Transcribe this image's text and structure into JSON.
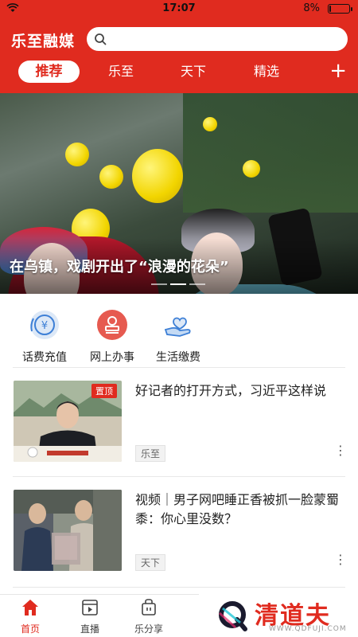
{
  "status_bar": {
    "time": "17:07",
    "battery": "8%",
    "battery_level": 0.08
  },
  "header": {
    "app_title": "乐至融媒",
    "search_placeholder": "",
    "tabs": [
      {
        "label": "推荐",
        "active": true
      },
      {
        "label": "乐至",
        "active": false
      },
      {
        "label": "天下",
        "active": false
      },
      {
        "label": "精选",
        "active": false
      }
    ],
    "add_tab_label": "+"
  },
  "banner": {
    "caption": "在乌镇，戏剧开出了“浪漫的花朵”",
    "slide_count": 3,
    "active_slide": 1
  },
  "services": [
    {
      "label": "话费充值",
      "icon": "phone-bill-icon",
      "color": "#3d7fd6"
    },
    {
      "label": "网上办事",
      "icon": "stamp-icon",
      "color": "#e44a44"
    },
    {
      "label": "生活缴费",
      "icon": "heart-hand-icon",
      "color": "#3d7fd6"
    }
  ],
  "news": [
    {
      "title": "好记者的打开方式，习近平这样说",
      "tag": "乐至",
      "pinned_label": "置顶"
    },
    {
      "title": "视频｜男子网吧睡正香被抓一脸蒙蜀黍：你心里没数？",
      "tag": "天下"
    }
  ],
  "bottom_nav": [
    {
      "label": "首页",
      "icon": "home-icon",
      "active": true
    },
    {
      "label": "直播",
      "icon": "live-video-icon",
      "active": false
    },
    {
      "label": "乐分享",
      "icon": "share-bag-icon",
      "active": false
    }
  ],
  "watermark": {
    "text": "清道夫",
    "url": "WWW.QDFUJI.COM"
  },
  "colors": {
    "brand_red": "#e02b1f"
  }
}
